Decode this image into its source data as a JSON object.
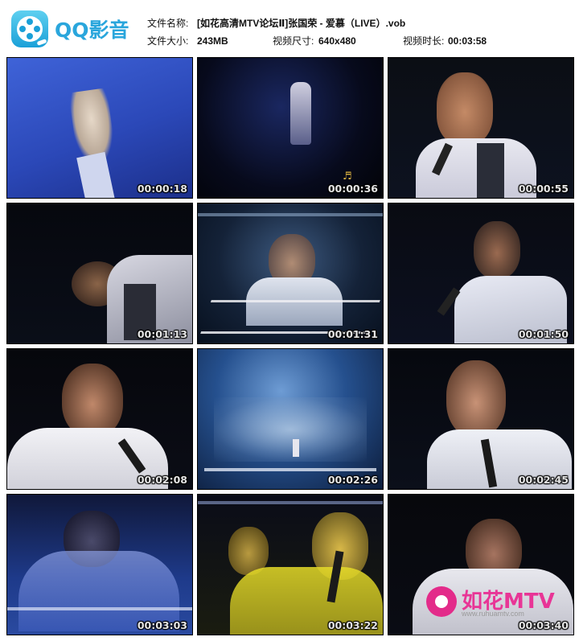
{
  "app": {
    "logo_text": "QQ影音",
    "logo_icon": "qq-player-icon"
  },
  "file_info": {
    "name_label": "文件名称:",
    "name_value": "[如花高清MTV论坛Ⅱ]张国荣 - 爱慕（LIVE）.vob",
    "size_label": "文件大小:",
    "size_value": "243MB",
    "dimensions_label": "视频尺寸:",
    "dimensions_value": "640x480",
    "duration_label": "视频时长:",
    "duration_value": "00:03:58"
  },
  "thumbnails": [
    {
      "timestamp": "00:00:18",
      "scene": "raised-hand-blue"
    },
    {
      "timestamp": "00:00:36",
      "scene": "singer-distant-stage"
    },
    {
      "timestamp": "00:00:55",
      "scene": "singer-closeup-mic"
    },
    {
      "timestamp": "00:01:13",
      "scene": "singer-bowing"
    },
    {
      "timestamp": "00:01:31",
      "scene": "singer-stage-lights"
    },
    {
      "timestamp": "00:01:50",
      "scene": "singer-side-mic"
    },
    {
      "timestamp": "00:02:08",
      "scene": "singer-white-shirt"
    },
    {
      "timestamp": "00:02:26",
      "scene": "stage-smoke-wide"
    },
    {
      "timestamp": "00:02:45",
      "scene": "singer-closeup-right"
    },
    {
      "timestamp": "00:03:03",
      "scene": "singer-blue-overlay"
    },
    {
      "timestamp": "00:03:22",
      "scene": "singer-yellow-overlay"
    },
    {
      "timestamp": "00:03:40",
      "scene": "singer-looking-down"
    }
  ],
  "watermark": {
    "text": "如花MTV",
    "url": "www.ruhuamtv.com",
    "color": "#e83596"
  },
  "colors": {
    "brand": "#2aa6dc",
    "timestamp": "#e6e6e6"
  }
}
